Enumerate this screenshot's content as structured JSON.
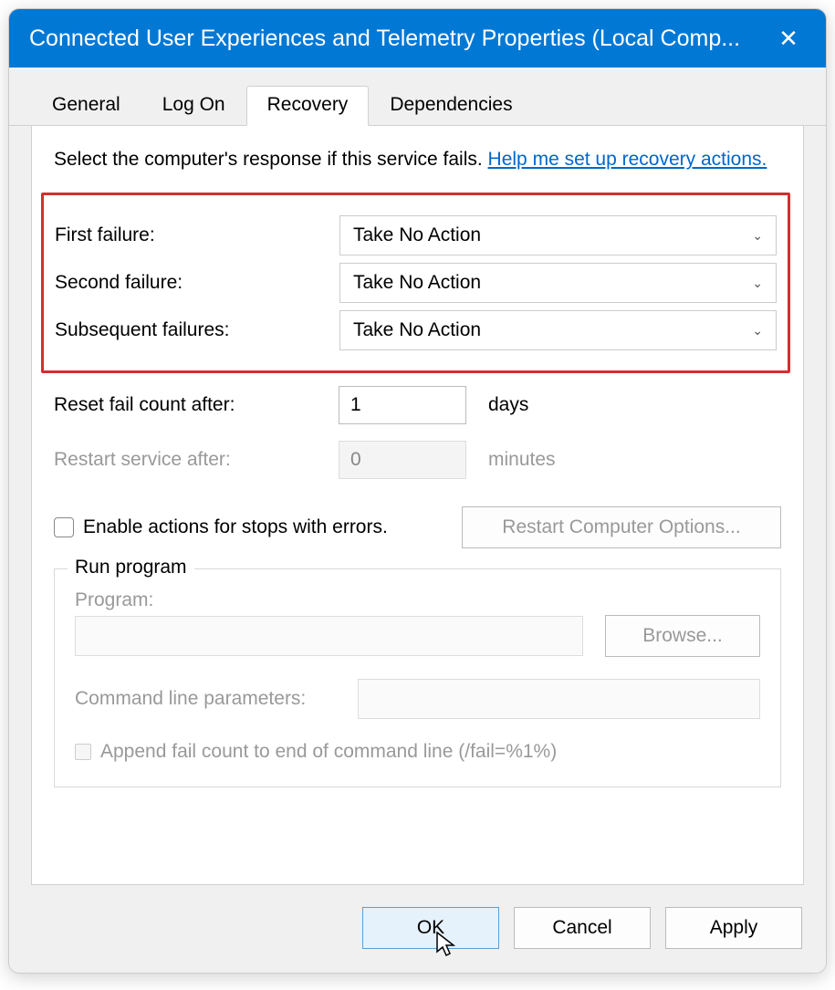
{
  "window": {
    "title": "Connected User Experiences and Telemetry Properties (Local Comp...",
    "close_glyph": "✕"
  },
  "tabs": {
    "general": "General",
    "logon": "Log On",
    "recovery": "Recovery",
    "dependencies": "Dependencies",
    "active": "recovery"
  },
  "intro": {
    "text": "Select the computer's response if this service fails. ",
    "link": "Help me set up recovery actions."
  },
  "failures": {
    "first_label": "First failure:",
    "first_value": "Take No Action",
    "second_label": "Second failure:",
    "second_value": "Take No Action",
    "subsequent_label": "Subsequent failures:",
    "subsequent_value": "Take No Action"
  },
  "reset": {
    "label": "Reset fail count after:",
    "value": "1",
    "unit": "days"
  },
  "restart": {
    "label": "Restart service after:",
    "value": "0",
    "unit": "minutes"
  },
  "enable_actions": {
    "label": "Enable actions for stops with errors.",
    "checked": false
  },
  "restart_computer_btn": "Restart Computer Options...",
  "run_program": {
    "legend": "Run program",
    "program_label": "Program:",
    "program_value": "",
    "browse": "Browse...",
    "cmd_label": "Command line parameters:",
    "cmd_value": "",
    "append_label": "Append fail count to end of command line (/fail=%1%)",
    "append_checked": false
  },
  "buttons": {
    "ok": "OK",
    "cancel": "Cancel",
    "apply": "Apply"
  }
}
